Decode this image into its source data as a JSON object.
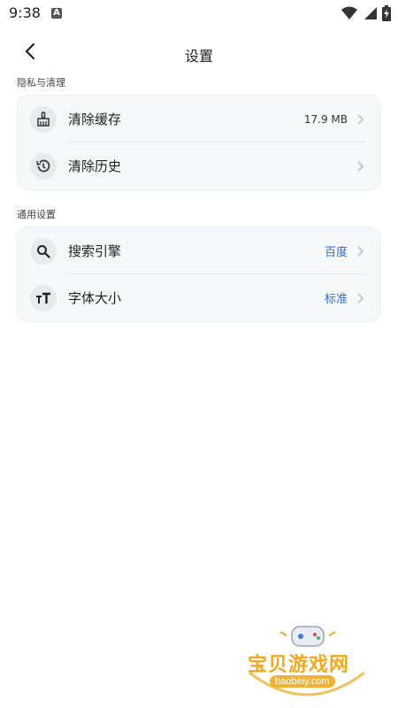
{
  "status_bar": {
    "time": "9:38",
    "notification_letter": "A",
    "icons": [
      "wifi-icon",
      "signal-icon",
      "battery-charging-icon"
    ]
  },
  "header": {
    "title": "设置",
    "back_icon": "chevron-left-icon"
  },
  "sections": [
    {
      "label": "隐私与清理",
      "items": [
        {
          "icon": "broom-icon",
          "label": "清除缓存",
          "value": "17.9 MB"
        },
        {
          "icon": "history-icon",
          "label": "清除历史",
          "value": ""
        }
      ]
    },
    {
      "label": "通用设置",
      "items": [
        {
          "icon": "search-icon",
          "label": "搜索引擎",
          "value": "百度"
        },
        {
          "icon": "font-size-icon",
          "label": "字体大小",
          "value": "标准"
        }
      ]
    }
  ],
  "colors": {
    "accent": "#2a6fd8",
    "card_bg": "#f7f8fa",
    "icon_bg": "#e9eaee"
  },
  "watermark": {
    "text": "宝贝游戏网",
    "url": "baobeiy.com"
  }
}
